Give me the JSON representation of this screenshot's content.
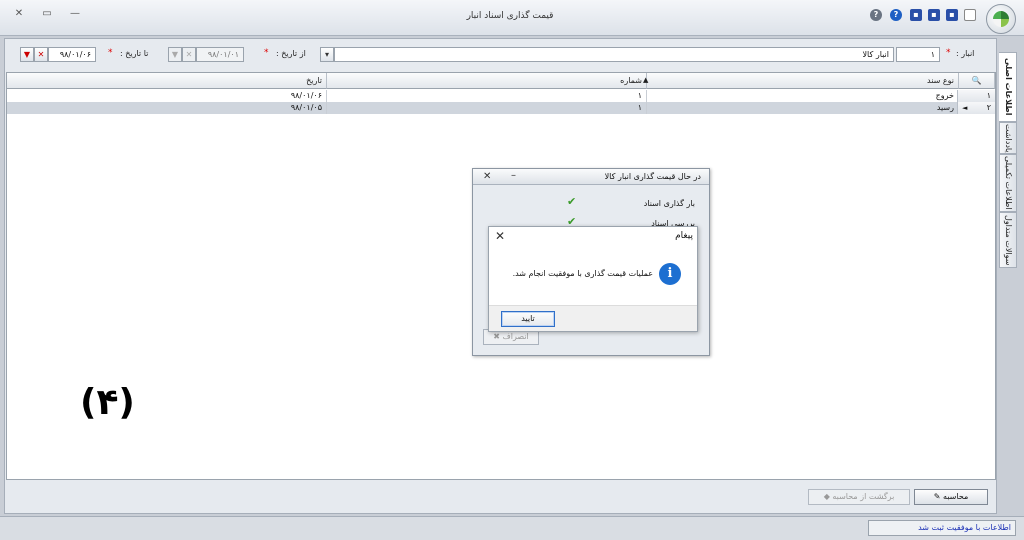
{
  "window": {
    "title": "قیمت گذاری اسناد انبار",
    "close_glyph": "✕",
    "restore_glyph": "▭",
    "minimize_glyph": "—"
  },
  "quick_toolbar": {
    "icons": [
      "help-icon",
      "info-icon",
      "save-icon",
      "save-as-icon",
      "save-all-icon",
      "new-document-icon"
    ]
  },
  "filters": {
    "warehouse_label": "انبار :",
    "warehouse_code": "۱",
    "warehouse_name": "انبار کالا",
    "from_date_label": "از تاریخ :",
    "from_date_value": "۹۸/۰۱/۰۱",
    "to_date_label": "تا تاریخ :",
    "to_date_value": "۹۸/۰۱/۰۶",
    "required_mark": "*"
  },
  "grid": {
    "columns": [
      "نوع سند",
      "شماره",
      "تاریخ"
    ],
    "rows": [
      {
        "num": "۱",
        "type": "خروج",
        "number": "۱",
        "date": "۹۸/۰۱/۰۶"
      },
      {
        "num": "۲",
        "type": "رسید",
        "number": "۱",
        "date": "۹۸/۰۱/۰۵"
      }
    ]
  },
  "side_tabs": [
    "اطلاعات اصلی",
    "یادداشت",
    "اطلاعات تکمیلی",
    "سوالات متداول"
  ],
  "annotation": "(۴)",
  "progress_dialog": {
    "title": "در حال قیمت گذاری انبار کالا",
    "steps": [
      "بار گذاری اسناد",
      "بررسی اسناد"
    ],
    "cancel_label": "انصراف"
  },
  "message_box": {
    "title": "پیغام",
    "message": "عملیات قیمت گذاری با موفقیت انجام شد.",
    "ok_label": "تایید"
  },
  "actions": {
    "calculate_label": "محاسبه",
    "revert_label": "برگشت از محاسبه"
  },
  "status": {
    "text": "اطلاعات با موفقیت ثبت شد"
  },
  "colors": {
    "accent": "#1d6fd1",
    "status_text": "#1a2fb5",
    "required": "#dd0000"
  }
}
